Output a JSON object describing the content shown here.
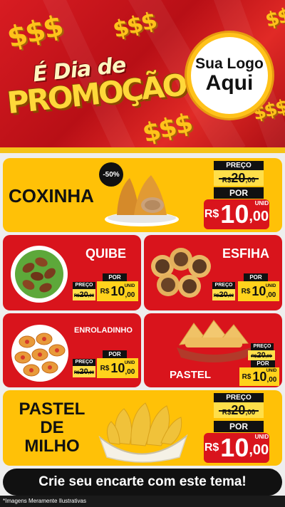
{
  "header": {
    "title_line1": "É Dia de",
    "title_line2": "PROMOÇÃO",
    "dollar_sign": "$$$",
    "logo_line1": "Sua Logo",
    "logo_line2": "Aqui"
  },
  "labels": {
    "preco": "PREÇO",
    "por": "POR",
    "currency": "R$",
    "unid": "UNID"
  },
  "products": {
    "coxinha": {
      "name": "COXINHA",
      "badge": "-50%",
      "old_int": "20",
      "old_dec": ",00",
      "new_int": "10",
      "new_dec": ",00"
    },
    "quibe": {
      "name": "QUIBE",
      "old_int": "20",
      "old_dec": ",00",
      "new_int": "10",
      "new_dec": ",00"
    },
    "esfiha": {
      "name": "ESFIHA",
      "old_int": "20",
      "old_dec": ",00",
      "new_int": "10",
      "new_dec": ",00"
    },
    "enroladinho": {
      "name": "ENROLADINHO",
      "old_int": "20",
      "old_dec": ",00",
      "new_int": "10",
      "new_dec": ",00"
    },
    "pastel": {
      "name": "PASTEL",
      "old_int": "20",
      "old_dec": ",00",
      "new_int": "10",
      "new_dec": ",00"
    },
    "pastel_milho": {
      "name_l1": "PASTEL",
      "name_l2": "DE",
      "name_l3": "MILHO",
      "old_int": "20",
      "old_dec": ",00",
      "new_int": "10",
      "new_dec": ",00"
    }
  },
  "footer": {
    "cta": "Crie seu encarte com este tema!",
    "disclaimer": "*Imagens Meramente Ilustrativas"
  },
  "colors": {
    "red": "#d9141c",
    "yellow": "#ffc107",
    "black": "#111111"
  }
}
